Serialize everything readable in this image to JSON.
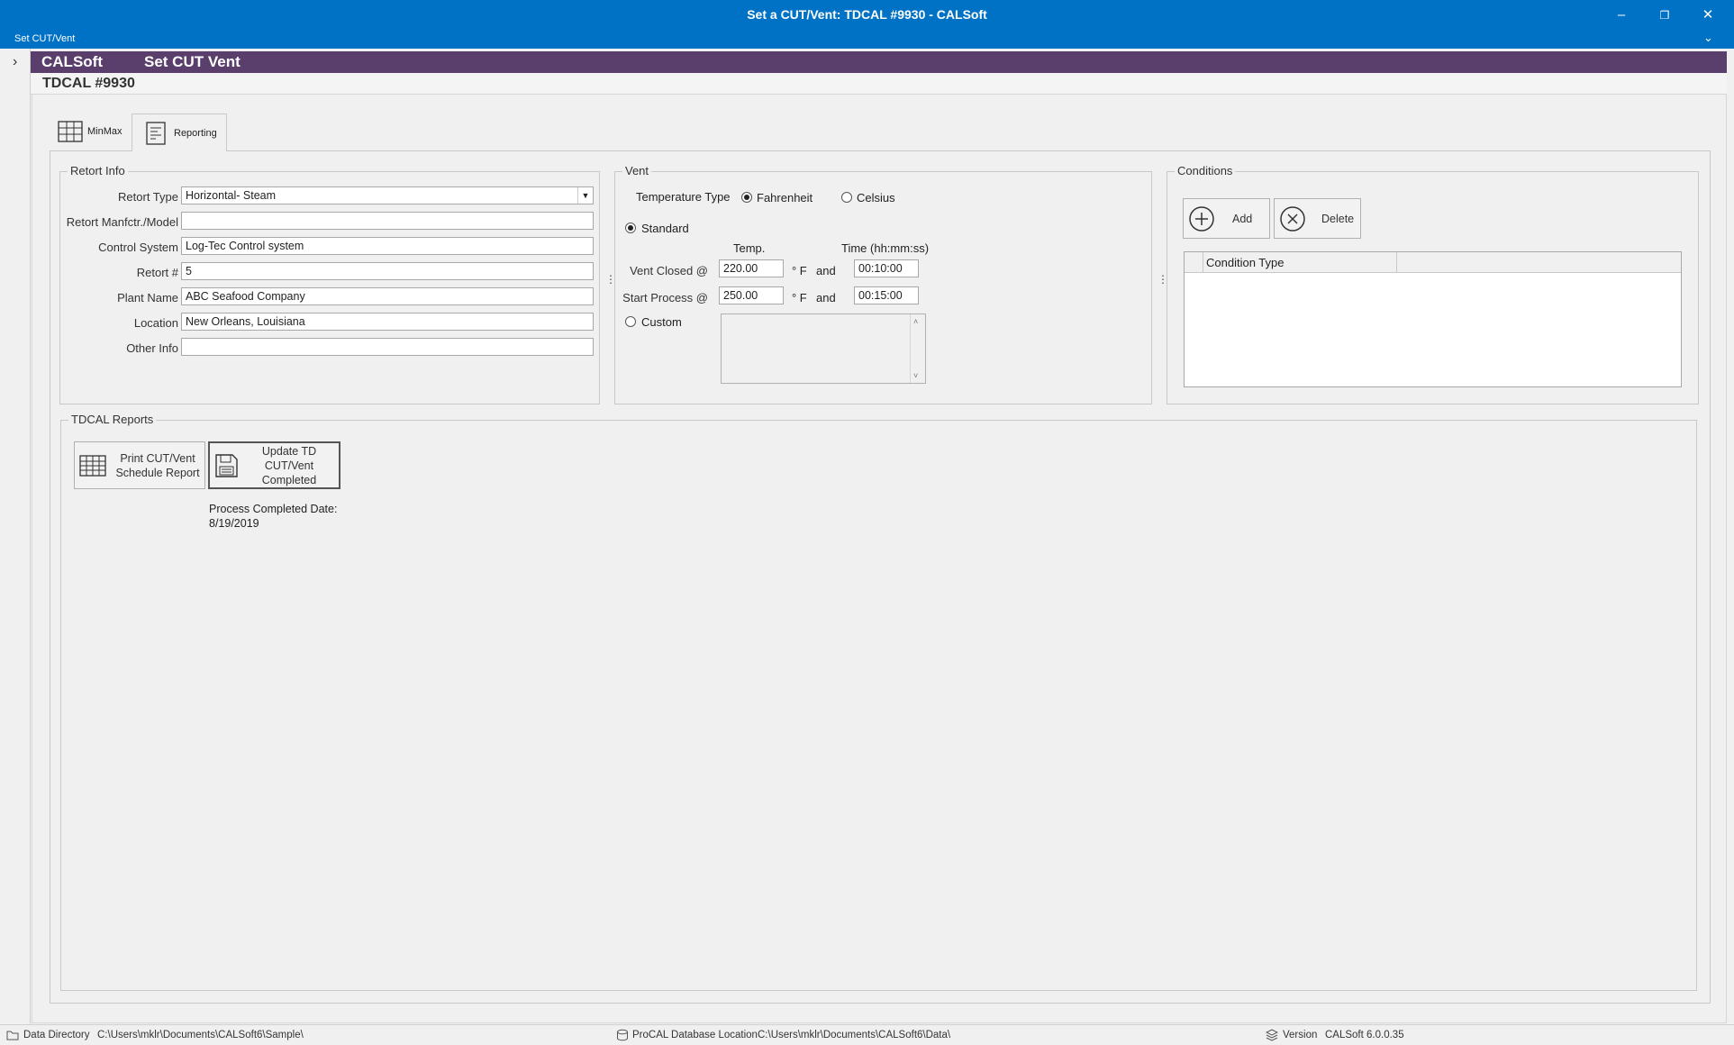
{
  "window": {
    "title": "Set a CUT/Vent: TDCAL #9930 - CALSoft"
  },
  "ribbon": {
    "label": "Set CUT/Vent"
  },
  "header": {
    "app": "CALSoft",
    "page": "Set CUT Vent",
    "subtitle": "TDCAL #9930"
  },
  "tabs": [
    {
      "label": "MinMax"
    },
    {
      "label": "Reporting"
    }
  ],
  "retort_info": {
    "title": "Retort Info",
    "fields": [
      {
        "label": "Retort Type",
        "value": "Horizontal- Steam"
      },
      {
        "label": "Retort Manfctr./Model",
        "value": ""
      },
      {
        "label": "Control System",
        "value": "Log-Tec Control system"
      },
      {
        "label": "Retort #",
        "value": "5"
      },
      {
        "label": "Plant Name",
        "value": "ABC Seafood Company"
      },
      {
        "label": "Location",
        "value": "New Orleans, Louisiana"
      },
      {
        "label": "Other Info",
        "value": ""
      }
    ]
  },
  "vent": {
    "title": "Vent",
    "temperature_type_label": "Temperature Type",
    "fahrenheit": "Fahrenheit",
    "celsius": "Celsius",
    "standard": "Standard",
    "temp_header": "Temp.",
    "time_header": "Time (hh:mm:ss)",
    "vent_closed": {
      "label": "Vent Closed @",
      "temp": "220.00",
      "time": "00:10:00"
    },
    "start_process": {
      "label": "Start Process @",
      "temp": "250.00",
      "time": "00:15:00"
    },
    "unit": "° F",
    "and": "and",
    "custom": "Custom"
  },
  "conditions": {
    "title": "Conditions",
    "add": "Add",
    "delete": "Delete",
    "column": "Condition Type"
  },
  "reports": {
    "title": "TDCAL Reports",
    "print_btn": "Print CUT/Vent Schedule Report",
    "update_btn": "Update TD CUT/Vent Completed",
    "completed_label": "Process Completed Date:",
    "completed_date": "8/19/2019"
  },
  "status": {
    "data_dir_label": "Data Directory",
    "data_dir": "C:\\Users\\mklr\\Documents\\CALSoft6\\Sample\\",
    "db_label": "ProCAL Database Location",
    "db": "C:\\Users\\mklr\\Documents\\CALSoft6\\Data\\",
    "version_label": "Version",
    "version": "CALSoft 6.0.0.35"
  },
  "colors": {
    "titlebar": "#0072c6",
    "header": "#5a3e6b"
  }
}
